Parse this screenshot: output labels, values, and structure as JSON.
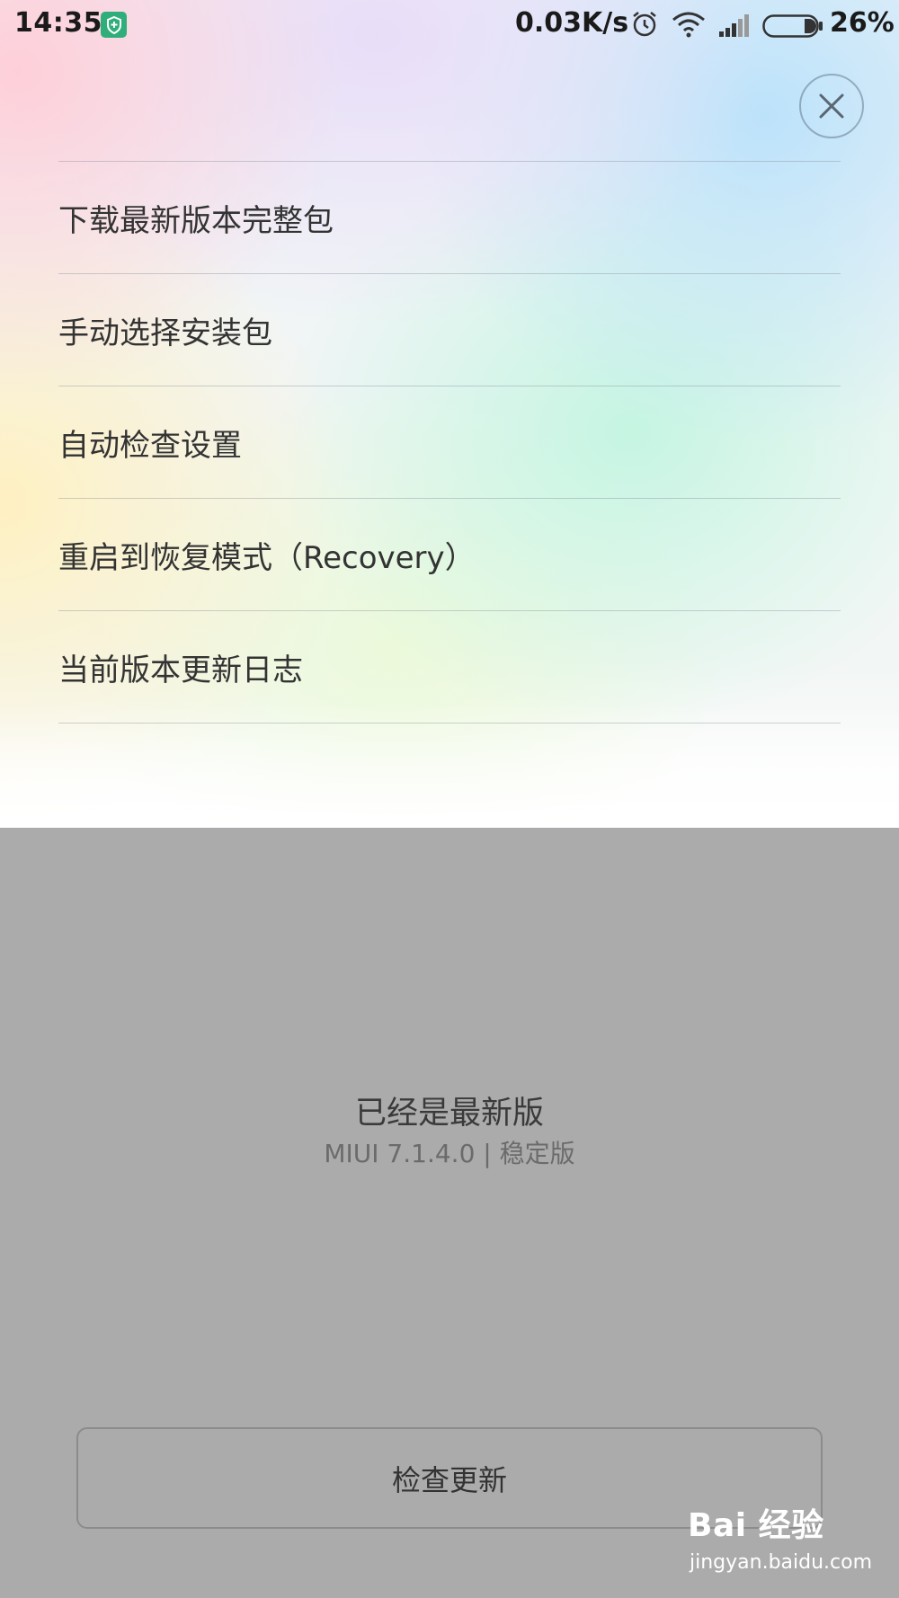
{
  "status_bar": {
    "time": "14:35",
    "network_speed": "0.03K/s",
    "battery_percent": "26%",
    "battery_level": 0.26,
    "icons": [
      "shield-icon",
      "alarm-icon",
      "wifi-icon",
      "signal-icon",
      "battery-icon"
    ]
  },
  "menu": {
    "items": [
      {
        "label": "下载最新版本完整包"
      },
      {
        "label": "手动选择安装包"
      },
      {
        "label": "自动检查设置"
      },
      {
        "label": "重启到恢复模式（Recovery）"
      },
      {
        "label": "当前版本更新日志"
      }
    ]
  },
  "update_status": {
    "title": "已经是最新版",
    "version": "MIUI 7.1.4.0 | 稳定版"
  },
  "check_button": {
    "label": "检查更新"
  },
  "watermark": {
    "logo_text": "Bai 经验",
    "url": "jingyan.baidu.com"
  },
  "colors": {
    "overlay": "#ababab",
    "shield_badge": "#2fae7b"
  }
}
